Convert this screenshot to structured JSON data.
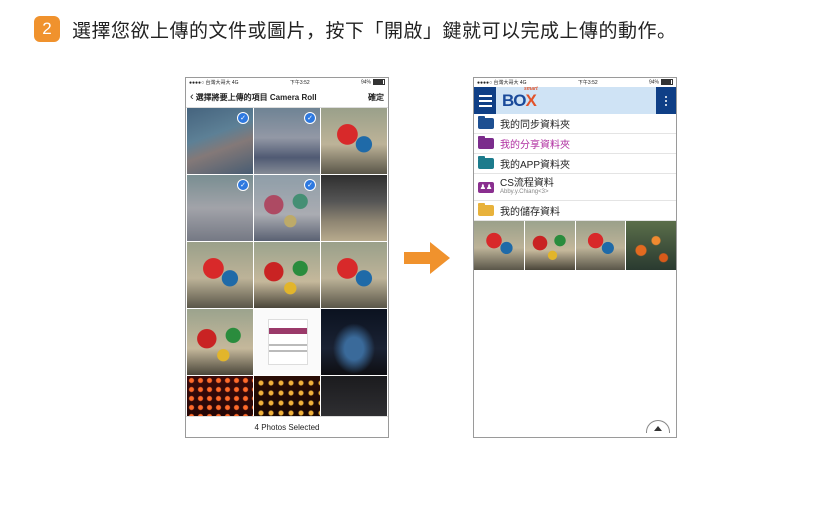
{
  "instruction": {
    "step_number": "2",
    "text": "選擇您欲上傳的文件或圖片，按下「開啟」鍵就可以完成上傳的動作。"
  },
  "left_phone": {
    "status": {
      "carrier": "●●●●○ 台灣大哥大  4G",
      "time": "下午3:52",
      "battery": "94%"
    },
    "nav": {
      "back_label": "選擇將要上傳的項目",
      "album": "Camera Roll",
      "confirm_label": "確定"
    },
    "photos": [
      {
        "thumb": "pond",
        "selected": true
      },
      {
        "thumb": "crowd",
        "selected": true
      },
      {
        "thumb": "macaw",
        "selected": false
      },
      {
        "thumb": "park",
        "selected": true
      },
      {
        "thumb": "macaw2",
        "selected": true
      },
      {
        "thumb": "people",
        "selected": false
      },
      {
        "thumb": "macaw",
        "selected": false
      },
      {
        "thumb": "macaw2",
        "selected": false
      },
      {
        "thumb": "macaw",
        "selected": false
      },
      {
        "thumb": "macaw2",
        "selected": false
      },
      {
        "thumb": "web",
        "selected": false
      },
      {
        "thumb": "church",
        "selected": false
      },
      {
        "thumb": "lanterns",
        "selected": false
      },
      {
        "thumb": "lanterns2",
        "selected": false
      },
      {
        "thumb": "dark",
        "selected": false
      }
    ],
    "footer_label": "4 Photos Selected"
  },
  "right_phone": {
    "status": {
      "carrier": "●●●●○ 台灣大哥大  4G",
      "time": "下午3:52",
      "battery": "94%"
    },
    "logo": {
      "smart": "smart",
      "box_prefix": "BO",
      "box_x": "X"
    },
    "folders": [
      {
        "name": "我的同步資料夾",
        "color": "#1d4f91"
      },
      {
        "name": "我的分享資料夾",
        "color": "#7b2c8c"
      },
      {
        "name": "我的APP資料夾",
        "color": "#1c7b8c"
      },
      {
        "name": "CS流程資料",
        "subtitle": "Abby.y.Chiang<3>",
        "color": "#8a2f8f"
      },
      {
        "name": "我的儲存資料",
        "color": "#e8b23b"
      }
    ],
    "photo_strip": [
      "macaw",
      "macaw2",
      "macaw",
      "koi"
    ]
  },
  "arrow": {
    "color": "#f0922d"
  },
  "colors": {
    "accent": "#f0922d",
    "app_blue": "#0f3f86",
    "check_blue": "#2e79e0"
  }
}
